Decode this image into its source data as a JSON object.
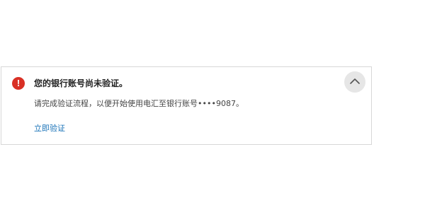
{
  "alert": {
    "status_icon": "error-exclamation-icon",
    "status_icon_glyph": "!",
    "status_color": "#d93025",
    "title": "您的银行账号尚未验证。",
    "body": "请完成验证流程，以便开始使用电汇至银行账号••••9087。",
    "action_link_label": "立即验证",
    "link_color": "#1a73b8",
    "collapse_icon": "chevron-up-icon"
  }
}
